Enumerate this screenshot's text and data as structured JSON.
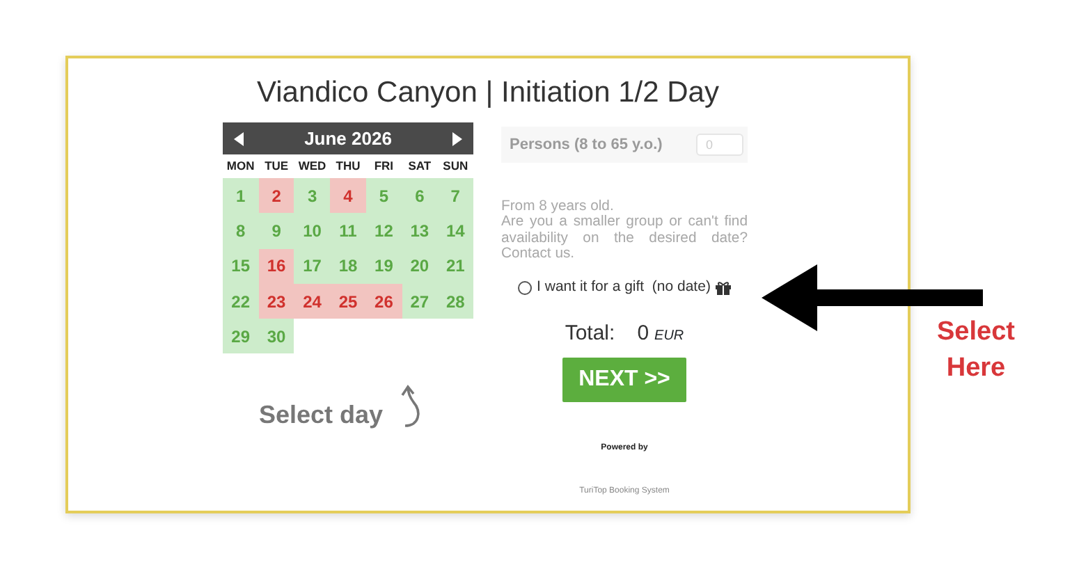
{
  "title": "Viandico Canyon | Initiation 1/2 Day",
  "calendar": {
    "month": "June 2026",
    "weekdays": [
      "MON",
      "TUE",
      "WED",
      "THU",
      "FRI",
      "SAT",
      "SUN"
    ],
    "weeks": [
      [
        {
          "day": "1",
          "available": true
        },
        {
          "day": "2",
          "available": false
        },
        {
          "day": "3",
          "available": true
        },
        {
          "day": "4",
          "available": false
        },
        {
          "day": "5",
          "available": true
        },
        {
          "day": "6",
          "available": true
        },
        {
          "day": "7",
          "available": true
        }
      ],
      [
        {
          "day": "8",
          "available": true
        },
        {
          "day": "9",
          "available": true
        },
        {
          "day": "10",
          "available": true
        },
        {
          "day": "11",
          "available": true
        },
        {
          "day": "12",
          "available": true
        },
        {
          "day": "13",
          "available": true
        },
        {
          "day": "14",
          "available": true
        }
      ],
      [
        {
          "day": "15",
          "available": true
        },
        {
          "day": "16",
          "available": false
        },
        {
          "day": "17",
          "available": true
        },
        {
          "day": "18",
          "available": true
        },
        {
          "day": "19",
          "available": true
        },
        {
          "day": "20",
          "available": true
        },
        {
          "day": "21",
          "available": true
        }
      ],
      [
        {
          "day": "22",
          "available": true
        },
        {
          "day": "23",
          "available": false
        },
        {
          "day": "24",
          "available": false
        },
        {
          "day": "25",
          "available": false
        },
        {
          "day": "26",
          "available": false
        },
        {
          "day": "27",
          "available": true
        },
        {
          "day": "28",
          "available": true
        }
      ],
      [
        {
          "day": "29",
          "available": true
        },
        {
          "day": "30",
          "available": true
        }
      ]
    ]
  },
  "hint": "Select day",
  "persons": {
    "label": "Persons (8 to 65 y.o.)",
    "value": "0"
  },
  "info": [
    "From 8 years old.",
    "Are you a smaller group or can't find availability on the desired date? Contact us."
  ],
  "gift": {
    "label": "I want it for a gift  (no date)",
    "checked": false
  },
  "total": {
    "label": "Total:",
    "amount": "0",
    "currency": "EUR"
  },
  "next": "NEXT >>",
  "powered_by": "Powered by",
  "system": "TuriTop Booking System",
  "annotation": "Select Here"
}
